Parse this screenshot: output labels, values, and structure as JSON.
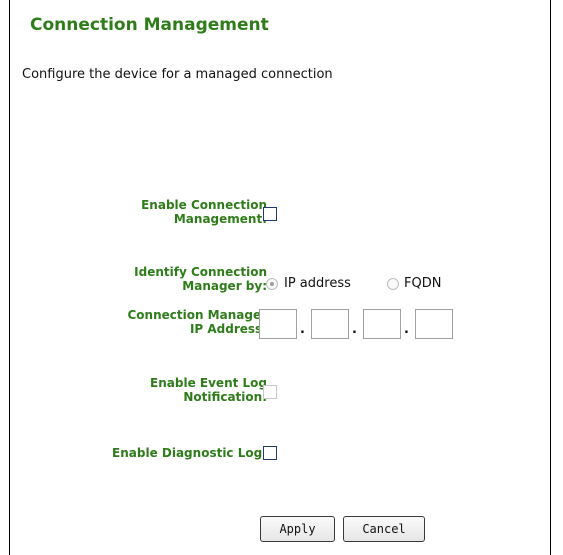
{
  "page": {
    "title": "Connection Management",
    "description": "Configure the device for a managed connection"
  },
  "form": {
    "enable_connection_management": {
      "label_line1": "Enable Connection",
      "label_line2": "Management:",
      "checked": false
    },
    "identify_by": {
      "label_line1": "Identify Connection",
      "label_line2": "Manager by:",
      "options": [
        {
          "label": "IP address",
          "selected": true,
          "disabled": true
        },
        {
          "label": "FQDN",
          "selected": false,
          "disabled": true
        }
      ]
    },
    "ip_address": {
      "label_line1": "Connection Manager",
      "label_line2": "IP Address:",
      "octets": [
        "",
        "",
        "",
        ""
      ],
      "separator": "."
    },
    "enable_event_log": {
      "label_line1": "Enable Event Log",
      "label_line2": "Notification:",
      "checked": false,
      "disabled": true
    },
    "enable_diagnostic_log": {
      "label": "Enable Diagnostic Log:",
      "checked": false
    }
  },
  "buttons": {
    "apply": "Apply",
    "cancel": "Cancel"
  },
  "colors": {
    "label_green": "#2e7d1a",
    "border": "#000000"
  }
}
